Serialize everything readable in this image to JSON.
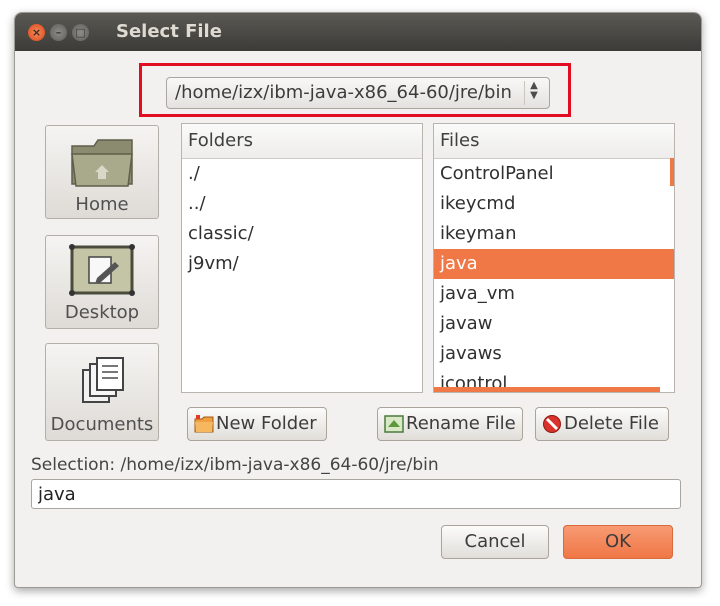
{
  "window": {
    "title": "Select File",
    "buttons": {
      "close": "×",
      "minimize": "–",
      "maximize": "□"
    }
  },
  "path_selector": {
    "value": "/home/izx/ibm-java-x86_64-60/jre/bin",
    "highlight_color": "#e30d22"
  },
  "places": [
    {
      "label": "Home",
      "icon": "home-folder-icon"
    },
    {
      "label": "Desktop",
      "icon": "desktop-icon"
    },
    {
      "label": "Documents",
      "icon": "documents-icon"
    }
  ],
  "folders": {
    "header": "Folders",
    "items": [
      "./",
      "../",
      "classic/",
      "j9vm/"
    ]
  },
  "files": {
    "header": "Files",
    "items": [
      "ControlPanel",
      "ikeycmd",
      "ikeyman",
      "java",
      "java_vm",
      "javaw",
      "javaws",
      "jcontrol"
    ],
    "selected": "java",
    "accent_color": "#f07746"
  },
  "actions": {
    "new_folder": "New Folder",
    "rename_file": "Rename File",
    "delete_file": "Delete File"
  },
  "selection": {
    "label": "Selection: /home/izx/ibm-java-x86_64-60/jre/bin",
    "value": "java"
  },
  "footer": {
    "cancel": "Cancel",
    "ok": "OK"
  }
}
